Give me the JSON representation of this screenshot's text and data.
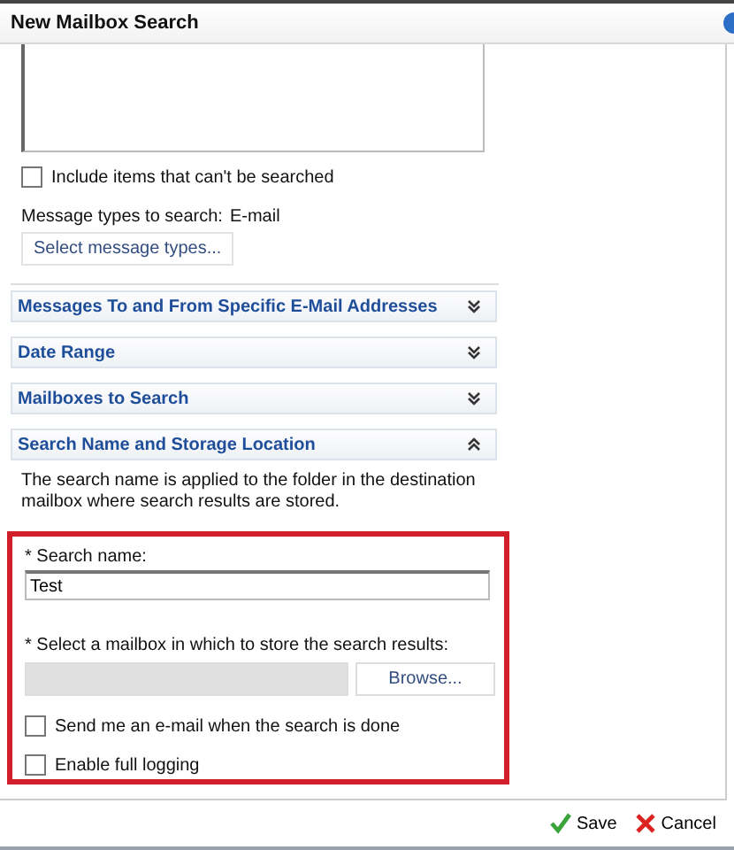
{
  "window": {
    "title": "New Mailbox Search"
  },
  "include_unsearchable": {
    "label": "Include items that can't be searched",
    "checked": false
  },
  "message_types": {
    "label": "Message types to search:",
    "value": "E-mail",
    "button": "Select message types..."
  },
  "sections": [
    {
      "title": "Messages To and From Specific E-Mail Addresses",
      "expanded": false
    },
    {
      "title": "Date Range",
      "expanded": false
    },
    {
      "title": "Mailboxes to Search",
      "expanded": false
    },
    {
      "title": "Search Name and Storage Location",
      "expanded": true
    }
  ],
  "section_description": "The search name is applied to the folder in the destination mailbox where search results are stored.",
  "search_name": {
    "label": "* Search name:",
    "value": "Test"
  },
  "storage_mailbox": {
    "label": "* Select a mailbox in which to store the search results:",
    "button": "Browse..."
  },
  "options": [
    {
      "label": "Send me an e-mail when the search is done",
      "checked": false
    },
    {
      "label": "Enable full logging",
      "checked": false
    }
  ],
  "buttons": [
    {
      "kind": "save",
      "label": "Save"
    },
    {
      "kind": "cancel",
      "label": "Cancel"
    }
  ]
}
